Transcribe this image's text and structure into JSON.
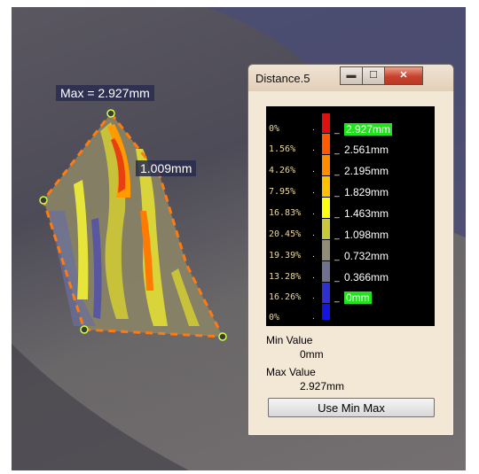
{
  "scene": {
    "max_label": "Max = 2.927mm",
    "point_label": "1.009mm"
  },
  "dialog": {
    "title": "Distance.5",
    "minimize_glyph": "▬",
    "maximize_glyph": "☐",
    "close_glyph": "✕",
    "legend": {
      "percentages": [
        "0%",
        "1.56%",
        "4.26%",
        "7.95%",
        "16.83%",
        "20.45%",
        "19.39%",
        "13.28%",
        "16.26%",
        "0%"
      ],
      "values": [
        "2.927mm",
        "2.561mm",
        "2.195mm",
        "1.829mm",
        "1.463mm",
        "1.098mm",
        "0.732mm",
        "0.366mm",
        "0mm"
      ],
      "colors": [
        "#e01010",
        "#ff5a00",
        "#ff8c00",
        "#ffc000",
        "#ffff10",
        "#c9c83a",
        "#8f8d78",
        "#707090",
        "#3030d0",
        "#1515e0"
      ],
      "highlight_color": "#22e21e"
    },
    "min_value_label": "Min Value",
    "min_value": "0mm",
    "max_value_label": "Max Value",
    "max_value": "2.927mm",
    "use_min_max_button": "Use Min Max"
  }
}
